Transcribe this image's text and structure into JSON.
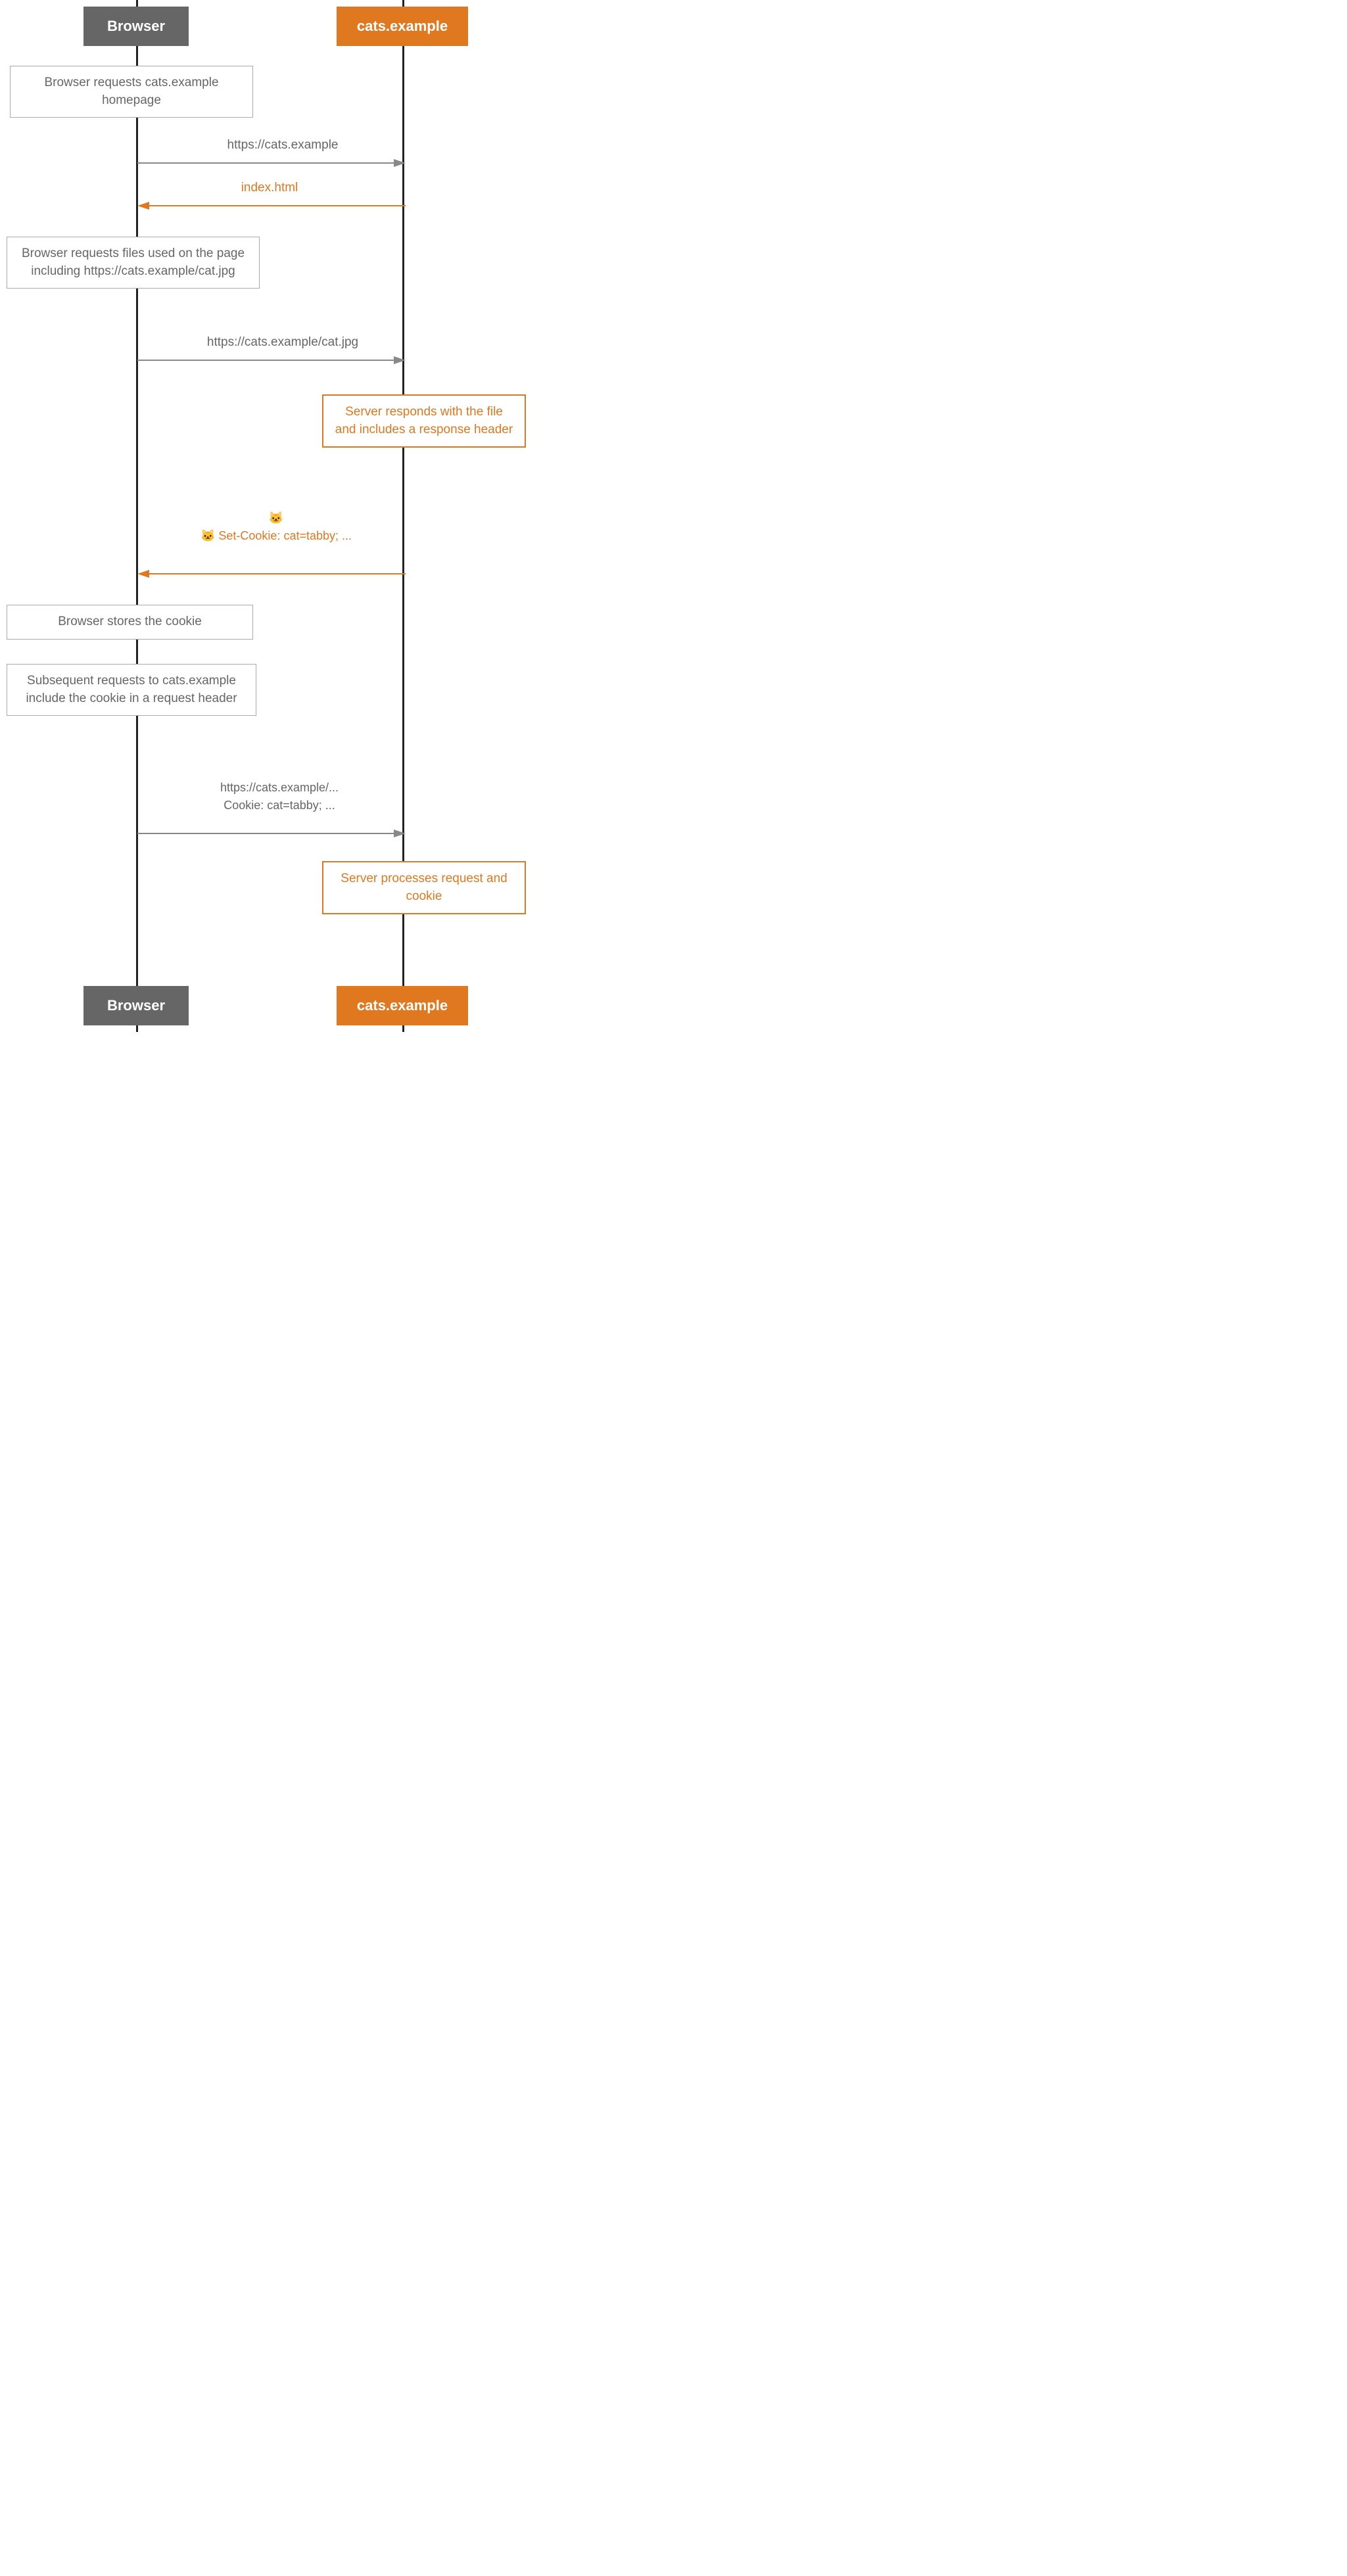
{
  "actors": {
    "browser_label": "Browser",
    "server_label": "cats.example"
  },
  "notes": [
    {
      "id": "note1",
      "text": "Browser requests cats.example homepage",
      "type": "normal"
    },
    {
      "id": "note2",
      "text": "Browser requests files used on the page including https://cats.example/cat.jpg",
      "type": "normal"
    },
    {
      "id": "note3",
      "text": "Server responds with the file and includes a response header",
      "type": "orange"
    },
    {
      "id": "note4",
      "text": "Browser stores the cookie",
      "type": "normal"
    },
    {
      "id": "note5",
      "text": "Subsequent requests to cats.example include the cookie in a request header",
      "type": "normal"
    },
    {
      "id": "note6",
      "text": "Server processes request and cookie",
      "type": "orange"
    }
  ],
  "arrows": [
    {
      "id": "arrow1",
      "label": "https://cats.example",
      "direction": "right",
      "type": "normal"
    },
    {
      "id": "arrow2",
      "label": "index.html",
      "direction": "left",
      "type": "orange"
    },
    {
      "id": "arrow3",
      "label": "https://cats.example/cat.jpg",
      "direction": "right",
      "type": "normal"
    },
    {
      "id": "arrow4",
      "label": "🐱 Set-Cookie: cat=tabby; ...",
      "direction": "left",
      "type": "orange"
    },
    {
      "id": "arrow5",
      "label": "https://cats.example/...\nCookie: cat=tabby; ...",
      "direction": "right",
      "type": "normal"
    }
  ]
}
